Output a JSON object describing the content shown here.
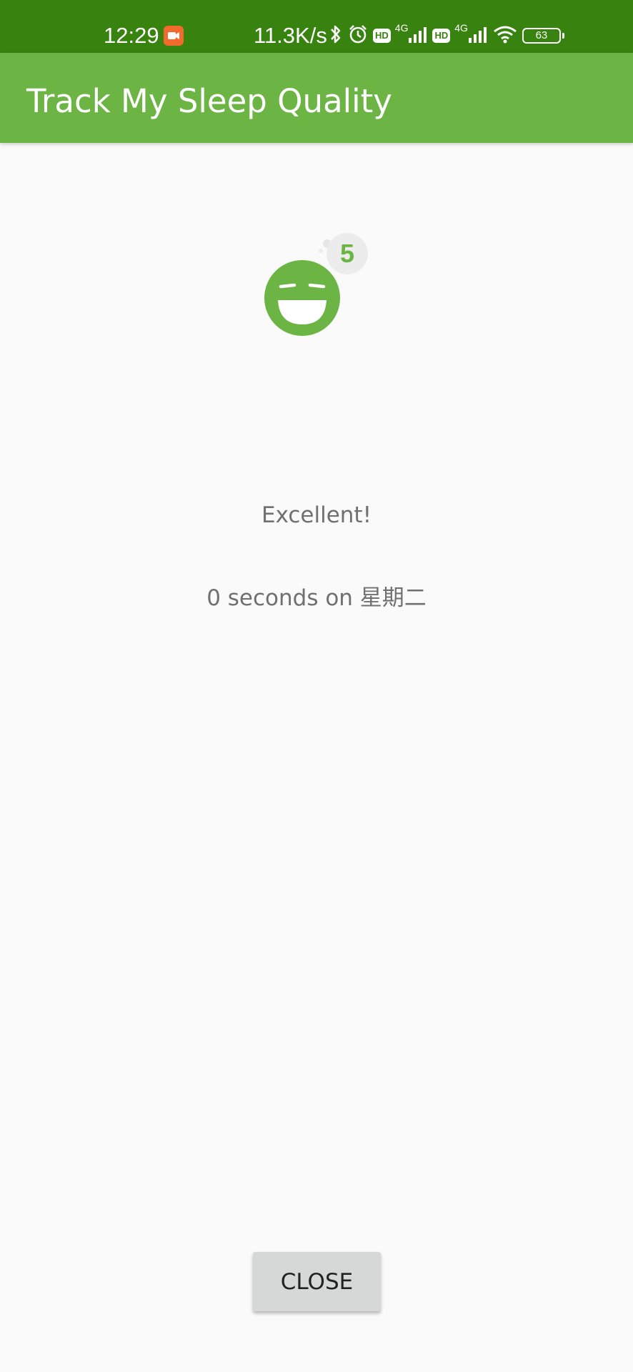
{
  "status_bar": {
    "time": "12:29",
    "speed": "11.3K/s",
    "hd_label": "HD",
    "network_type": "4G",
    "battery": "63",
    "icons": [
      "screen-record-icon",
      "bluetooth-icon",
      "alarm-icon",
      "hd-icon",
      "cellular-signal-icon",
      "wifi-icon",
      "battery-icon"
    ]
  },
  "app_bar": {
    "title": "Track My Sleep Quality"
  },
  "quality": {
    "icon": "laughing-face-icon",
    "rating": "5",
    "label": "Excellent!"
  },
  "sleep_info": "0 seconds on 星期二",
  "close_button": {
    "label": "CLOSE"
  },
  "colors": {
    "status_bar": "#38820f",
    "app_bar": "#6cb443",
    "face": "#6cb443",
    "background": "#fafafa",
    "button": "#d6d7d7"
  }
}
